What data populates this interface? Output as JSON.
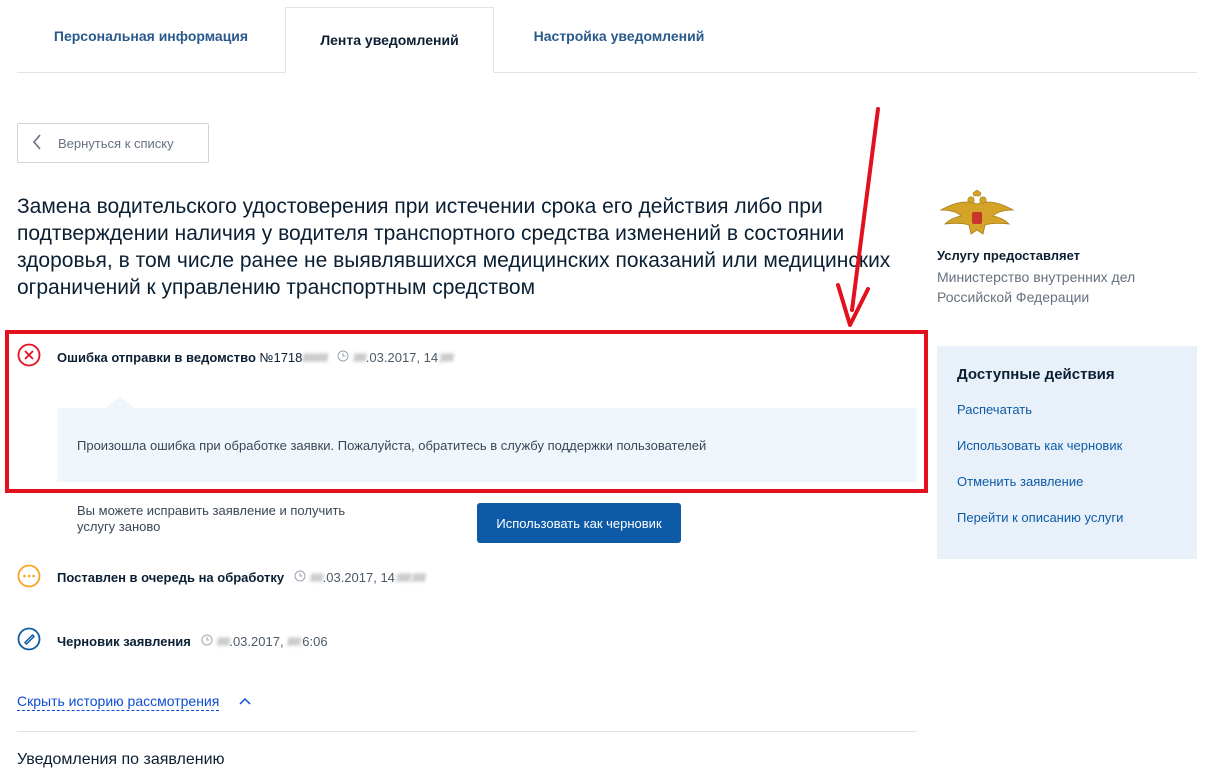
{
  "tabs": [
    {
      "label": "Персональная информация",
      "active": false
    },
    {
      "label": "Лента уведомлений",
      "active": true
    },
    {
      "label": "Настройка уведомлений",
      "active": false
    }
  ],
  "back_button": {
    "label": "Вернуться к списку",
    "icon": "chevron-left-icon"
  },
  "service_title": "Замена водительского удостоверения при истечении срока его действия либо при подтверждении наличия у водителя транспортного средства изменений в состоянии здоровья, в том числе ранее не выявлявшихся медицинских показаний или медицинских ограничений к управлению транспортным средством",
  "history": [
    {
      "status": "Ошибка отправки в ведомство",
      "number_prefix": "№1718",
      "number_redacted": "####",
      "date_redacted": "##",
      "date_visible": ".03.2017, 14",
      "time_redacted": ":##",
      "icon": "error-circle-icon",
      "color": "#e3101e"
    },
    {
      "status": "Поставлен в очередь на обработку",
      "date_redacted": "##",
      "date_visible": ".03.2017, 14",
      "time_redacted": ":##:##",
      "icon": "queue-dots-icon",
      "color": "#f5a623"
    },
    {
      "status": "Черновик заявления",
      "date_redacted": "##",
      "date_visible": ".03.2017, ",
      "time_redacted": "##:",
      "time_visible": "6:06",
      "icon": "draft-pencil-icon",
      "color": "#0d5ba7"
    }
  ],
  "error_message": "Произошла ошибка при обработке заявки. Пожалуйста, обратитесь в службу поддержки пользователей",
  "fix_hint": "Вы можете исправить заявление и получить услугу заново",
  "draft_button": "Использовать как черновик",
  "hide_history_link": "Скрыть историю рассмотрения",
  "notifications_heading": "Уведомления по заявлению",
  "provider": {
    "label": "Услугу предоставляет",
    "name": "Министерство внутренних дел Российской Федерации",
    "logo_icon": "double-headed-eagle-icon"
  },
  "actions": {
    "title": "Доступные действия",
    "items": [
      "Распечатать",
      "Использовать как черновик",
      "Отменить заявление",
      "Перейти к описанию услуги"
    ]
  },
  "colors": {
    "accent": "#0d5ba7",
    "error": "#e3101e",
    "panel": "#e8f1fa",
    "annotation": "#e3101e"
  }
}
